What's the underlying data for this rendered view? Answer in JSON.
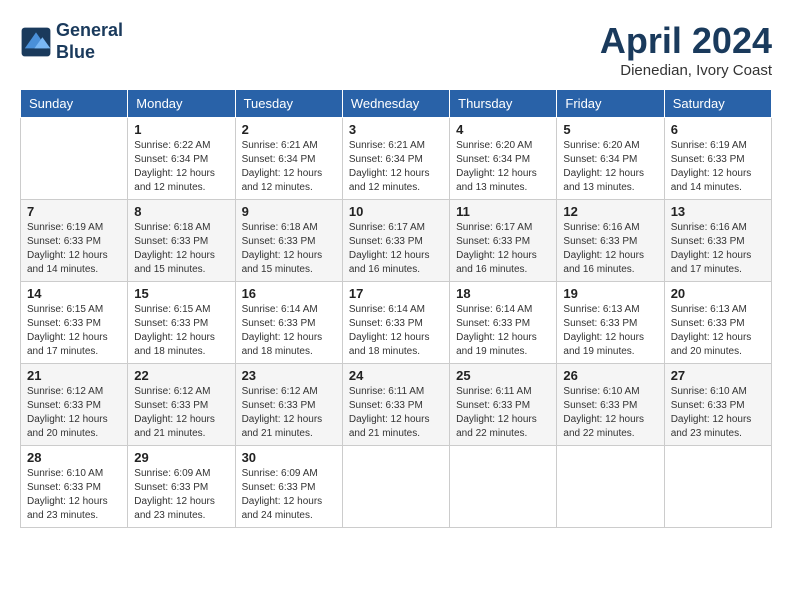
{
  "header": {
    "logo_line1": "General",
    "logo_line2": "Blue",
    "month_title": "April 2024",
    "location": "Dienedian, Ivory Coast"
  },
  "weekdays": [
    "Sunday",
    "Monday",
    "Tuesday",
    "Wednesday",
    "Thursday",
    "Friday",
    "Saturday"
  ],
  "weeks": [
    [
      {
        "day": "",
        "info": ""
      },
      {
        "day": "1",
        "info": "Sunrise: 6:22 AM\nSunset: 6:34 PM\nDaylight: 12 hours\nand 12 minutes."
      },
      {
        "day": "2",
        "info": "Sunrise: 6:21 AM\nSunset: 6:34 PM\nDaylight: 12 hours\nand 12 minutes."
      },
      {
        "day": "3",
        "info": "Sunrise: 6:21 AM\nSunset: 6:34 PM\nDaylight: 12 hours\nand 12 minutes."
      },
      {
        "day": "4",
        "info": "Sunrise: 6:20 AM\nSunset: 6:34 PM\nDaylight: 12 hours\nand 13 minutes."
      },
      {
        "day": "5",
        "info": "Sunrise: 6:20 AM\nSunset: 6:34 PM\nDaylight: 12 hours\nand 13 minutes."
      },
      {
        "day": "6",
        "info": "Sunrise: 6:19 AM\nSunset: 6:33 PM\nDaylight: 12 hours\nand 14 minutes."
      }
    ],
    [
      {
        "day": "7",
        "info": "Sunrise: 6:19 AM\nSunset: 6:33 PM\nDaylight: 12 hours\nand 14 minutes."
      },
      {
        "day": "8",
        "info": "Sunrise: 6:18 AM\nSunset: 6:33 PM\nDaylight: 12 hours\nand 15 minutes."
      },
      {
        "day": "9",
        "info": "Sunrise: 6:18 AM\nSunset: 6:33 PM\nDaylight: 12 hours\nand 15 minutes."
      },
      {
        "day": "10",
        "info": "Sunrise: 6:17 AM\nSunset: 6:33 PM\nDaylight: 12 hours\nand 16 minutes."
      },
      {
        "day": "11",
        "info": "Sunrise: 6:17 AM\nSunset: 6:33 PM\nDaylight: 12 hours\nand 16 minutes."
      },
      {
        "day": "12",
        "info": "Sunrise: 6:16 AM\nSunset: 6:33 PM\nDaylight: 12 hours\nand 16 minutes."
      },
      {
        "day": "13",
        "info": "Sunrise: 6:16 AM\nSunset: 6:33 PM\nDaylight: 12 hours\nand 17 minutes."
      }
    ],
    [
      {
        "day": "14",
        "info": "Sunrise: 6:15 AM\nSunset: 6:33 PM\nDaylight: 12 hours\nand 17 minutes."
      },
      {
        "day": "15",
        "info": "Sunrise: 6:15 AM\nSunset: 6:33 PM\nDaylight: 12 hours\nand 18 minutes."
      },
      {
        "day": "16",
        "info": "Sunrise: 6:14 AM\nSunset: 6:33 PM\nDaylight: 12 hours\nand 18 minutes."
      },
      {
        "day": "17",
        "info": "Sunrise: 6:14 AM\nSunset: 6:33 PM\nDaylight: 12 hours\nand 18 minutes."
      },
      {
        "day": "18",
        "info": "Sunrise: 6:14 AM\nSunset: 6:33 PM\nDaylight: 12 hours\nand 19 minutes."
      },
      {
        "day": "19",
        "info": "Sunrise: 6:13 AM\nSunset: 6:33 PM\nDaylight: 12 hours\nand 19 minutes."
      },
      {
        "day": "20",
        "info": "Sunrise: 6:13 AM\nSunset: 6:33 PM\nDaylight: 12 hours\nand 20 minutes."
      }
    ],
    [
      {
        "day": "21",
        "info": "Sunrise: 6:12 AM\nSunset: 6:33 PM\nDaylight: 12 hours\nand 20 minutes."
      },
      {
        "day": "22",
        "info": "Sunrise: 6:12 AM\nSunset: 6:33 PM\nDaylight: 12 hours\nand 21 minutes."
      },
      {
        "day": "23",
        "info": "Sunrise: 6:12 AM\nSunset: 6:33 PM\nDaylight: 12 hours\nand 21 minutes."
      },
      {
        "day": "24",
        "info": "Sunrise: 6:11 AM\nSunset: 6:33 PM\nDaylight: 12 hours\nand 21 minutes."
      },
      {
        "day": "25",
        "info": "Sunrise: 6:11 AM\nSunset: 6:33 PM\nDaylight: 12 hours\nand 22 minutes."
      },
      {
        "day": "26",
        "info": "Sunrise: 6:10 AM\nSunset: 6:33 PM\nDaylight: 12 hours\nand 22 minutes."
      },
      {
        "day": "27",
        "info": "Sunrise: 6:10 AM\nSunset: 6:33 PM\nDaylight: 12 hours\nand 23 minutes."
      }
    ],
    [
      {
        "day": "28",
        "info": "Sunrise: 6:10 AM\nSunset: 6:33 PM\nDaylight: 12 hours\nand 23 minutes."
      },
      {
        "day": "29",
        "info": "Sunrise: 6:09 AM\nSunset: 6:33 PM\nDaylight: 12 hours\nand 23 minutes."
      },
      {
        "day": "30",
        "info": "Sunrise: 6:09 AM\nSunset: 6:33 PM\nDaylight: 12 hours\nand 24 minutes."
      },
      {
        "day": "",
        "info": ""
      },
      {
        "day": "",
        "info": ""
      },
      {
        "day": "",
        "info": ""
      },
      {
        "day": "",
        "info": ""
      }
    ]
  ]
}
